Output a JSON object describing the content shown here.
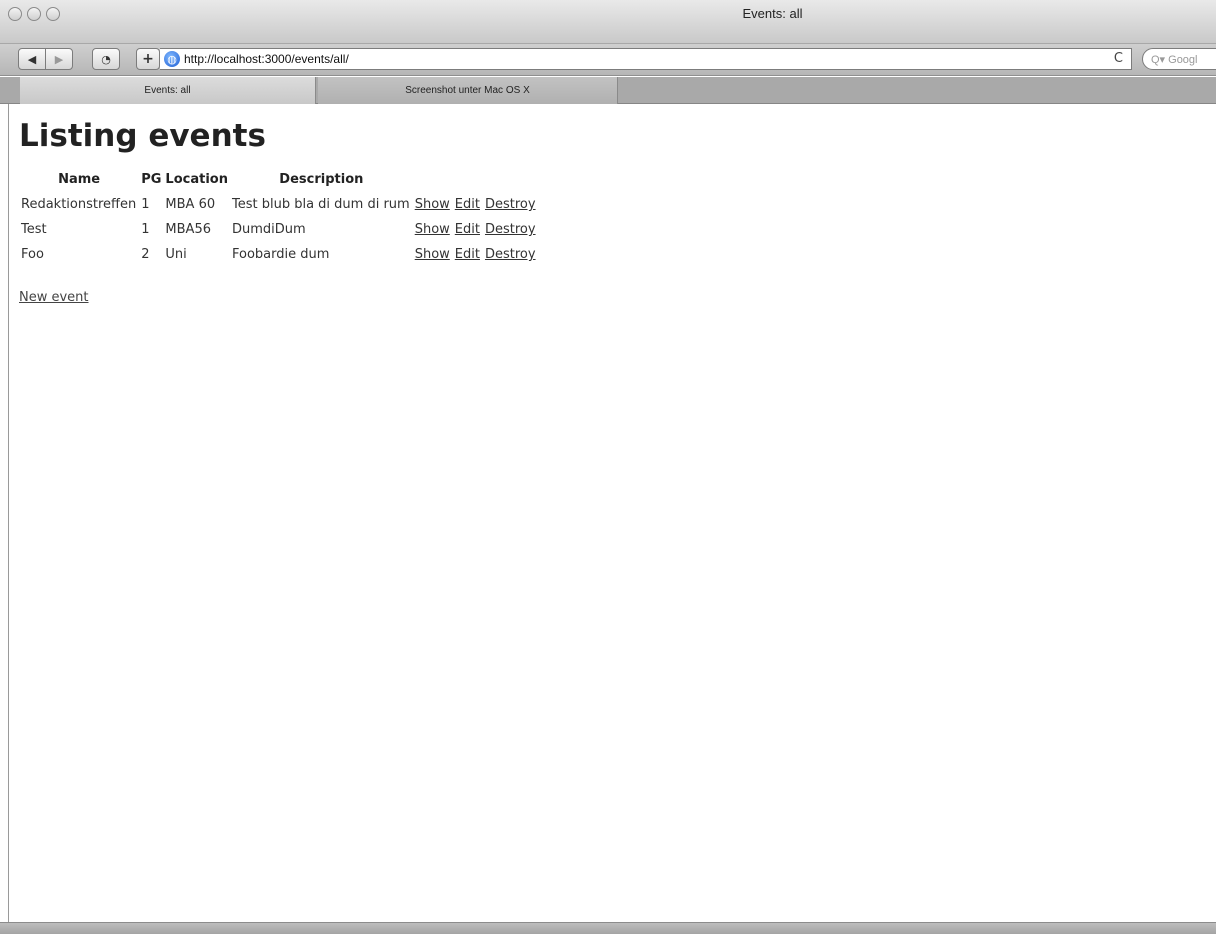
{
  "window": {
    "title": "Events: all"
  },
  "toolbar": {
    "back_label": "◀",
    "forward_label": "▶",
    "nav_label": "◔",
    "add_label": "+",
    "url": "http://localhost:3000/events/all/",
    "reload_label": "C",
    "search_placeholder": "Q▾ Googl"
  },
  "tabs": [
    {
      "label": "Events: all"
    },
    {
      "label": "Screenshot unter Mac OS X"
    }
  ],
  "page": {
    "heading": "Listing events",
    "columns": [
      "Name",
      "PG",
      "Location",
      "Description"
    ],
    "rows": [
      {
        "name": "Redaktionstreffen",
        "pg": "1",
        "location": "MBA 60",
        "description": "Test blub bla di dum di rum",
        "show": "Show",
        "edit": "Edit",
        "destroy": "Destroy"
      },
      {
        "name": "Test",
        "pg": "1",
        "location": "MBA56",
        "description": "DumdiDum",
        "show": "Show",
        "edit": "Edit",
        "destroy": "Destroy"
      },
      {
        "name": "Foo",
        "pg": "2",
        "location": "Uni",
        "description": "Foobardie dum",
        "show": "Show",
        "edit": "Edit",
        "destroy": "Destroy"
      }
    ],
    "new_event_label": "New event"
  },
  "icons": {
    "globe": "globe-icon",
    "reload": "reload-icon",
    "back": "back-arrow-icon",
    "forward": "forward-arrow-icon"
  }
}
